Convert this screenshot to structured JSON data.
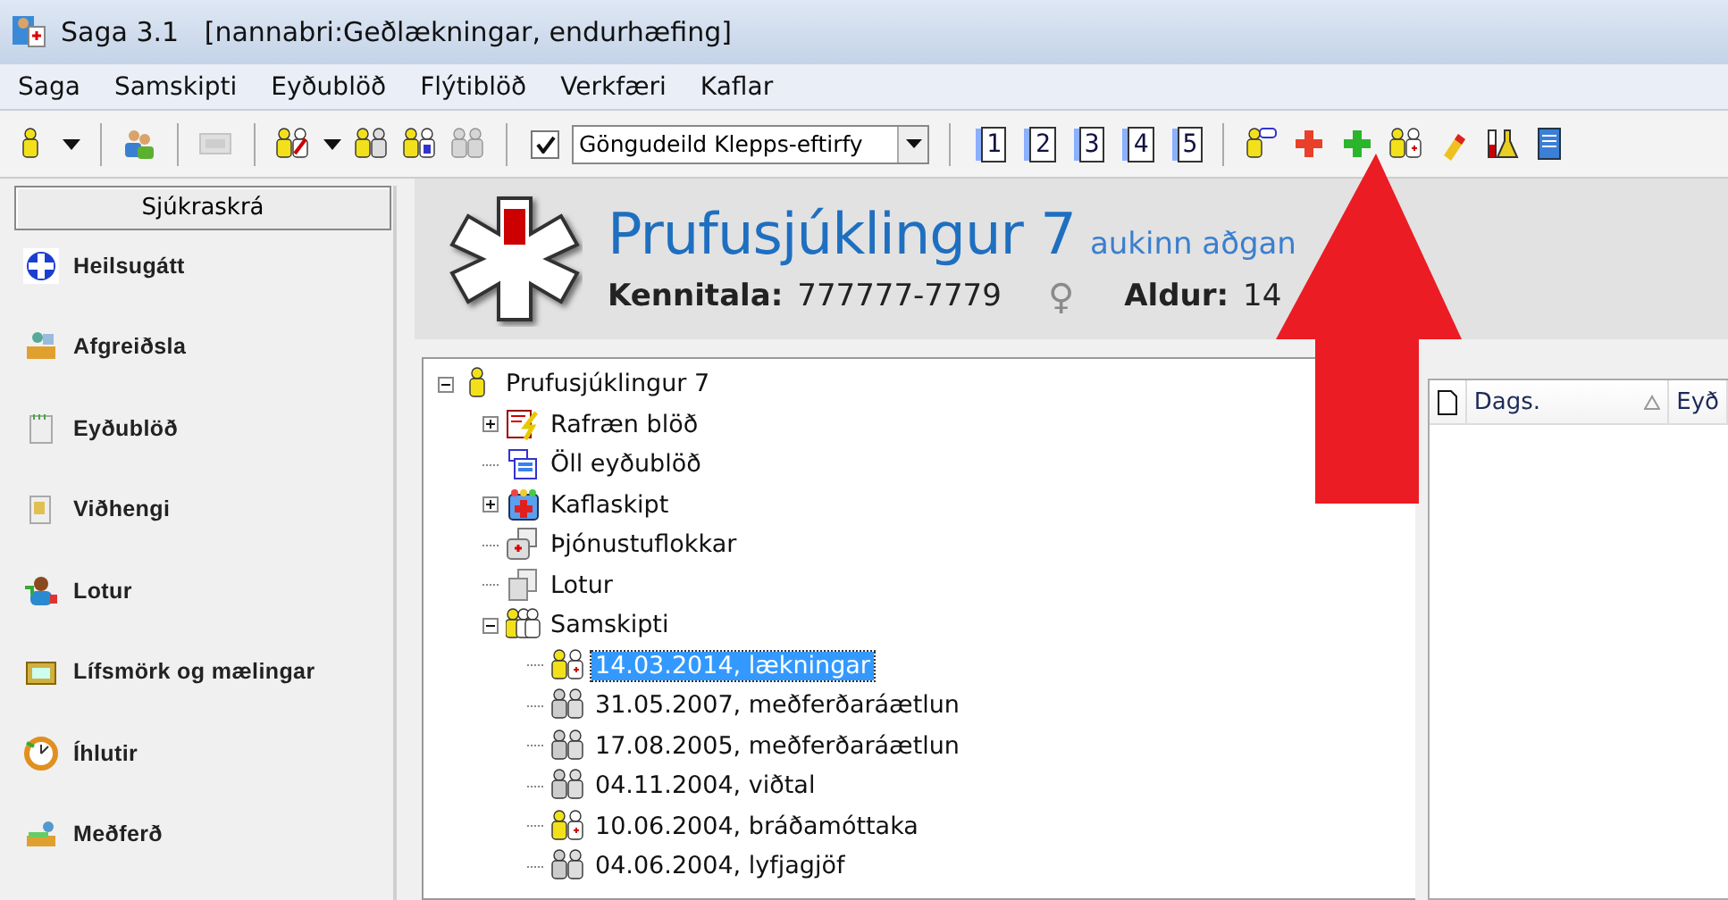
{
  "window": {
    "title": "Saga 3.1   [nannabri:Geðlækningar, endurhæfing]"
  },
  "menu": [
    "Saga",
    "Samskipti",
    "Eyðublöð",
    "Flýtiblöð",
    "Verkfæri",
    "Kaflar"
  ],
  "toolbar": [
    {
      "kind": "icon"
    },
    {
      "kind": "caret"
    },
    {
      "kind": "separator"
    },
    {
      "kind": "icon"
    },
    {
      "kind": "separator"
    },
    {
      "kind": "icon",
      "disabled": true
    },
    {
      "kind": "separator"
    },
    {
      "kind": "icon"
    },
    {
      "kind": "caret"
    },
    {
      "kind": "icon"
    },
    {
      "kind": "icon"
    },
    {
      "kind": "icon",
      "disabled": true
    },
    {
      "kind": "separator"
    },
    {
      "kind": "checkbox",
      "checked": true
    },
    {
      "kind": "combo",
      "value": "Göngudeild Klepps-eftirfy"
    },
    {
      "kind": "separator"
    },
    {
      "kind": "number",
      "label": "1"
    },
    {
      "kind": "number",
      "label": "2"
    },
    {
      "kind": "number",
      "label": "3"
    },
    {
      "kind": "number",
      "label": "4"
    },
    {
      "kind": "number",
      "label": "5"
    },
    {
      "kind": "separator"
    },
    {
      "kind": "icon"
    },
    {
      "kind": "icon"
    },
    {
      "kind": "icon"
    },
    {
      "kind": "icon"
    },
    {
      "kind": "icon"
    },
    {
      "kind": "icon"
    },
    {
      "kind": "icon"
    }
  ],
  "sidebar": {
    "title": "Sjúkraskrá",
    "items": [
      "Heilsugátt",
      "Afgreiðsla",
      "Eyðublöð",
      "Viðhengi",
      "Lotur",
      "Lífsmörk og mælingar",
      "Íhlutir",
      "Meðferð"
    ]
  },
  "patient": {
    "name": "Prufusjúklingur 7",
    "access": "aukinn aðgan",
    "id_label": "Kennitala:",
    "id": "777777-7779",
    "sex_symbol": "♀",
    "age_label": "Aldur:",
    "age": "14"
  },
  "tree": [
    {
      "label": "Prufusjúklingur 7",
      "kind": "patient",
      "expanded": true,
      "selected": false,
      "children": [
        {
          "label": "Rafræn blöð",
          "kind": "signed-forms",
          "expanded": false,
          "selected": false
        },
        {
          "label": "Öll eyðublöð",
          "kind": "forms",
          "selected": false
        },
        {
          "label": "Kaflaskipt",
          "kind": "chapters",
          "expanded": false,
          "selected": false
        },
        {
          "label": "Þjónustuflokkar",
          "kind": "services",
          "selected": false
        },
        {
          "label": "Lotur",
          "kind": "sessions",
          "selected": false
        },
        {
          "label": "Samskipti",
          "kind": "contacts",
          "expanded": true,
          "selected": false,
          "children": [
            {
              "label": "14.03.2014, lækningar",
              "kind": "contact-active",
              "selected": true
            },
            {
              "label": "31.05.2007, meðferðaráætlun",
              "kind": "contact-inactive",
              "selected": false
            },
            {
              "label": "17.08.2005, meðferðaráætlun",
              "kind": "contact-inactive",
              "selected": false
            },
            {
              "label": "04.11.2004, viðtal",
              "kind": "contact-inactive",
              "selected": false
            },
            {
              "label": "10.06.2004, bráðamóttaka",
              "kind": "contact-active",
              "selected": false
            },
            {
              "label": "04.06.2004, lyfjagjöf",
              "kind": "contact-inactive",
              "selected": false
            }
          ]
        }
      ]
    }
  ],
  "list": {
    "columns": [
      {
        "label": "Dags.",
        "sorted": true
      },
      {
        "label": "Eyð"
      }
    ]
  },
  "annotation": {
    "kind": "arrow"
  }
}
